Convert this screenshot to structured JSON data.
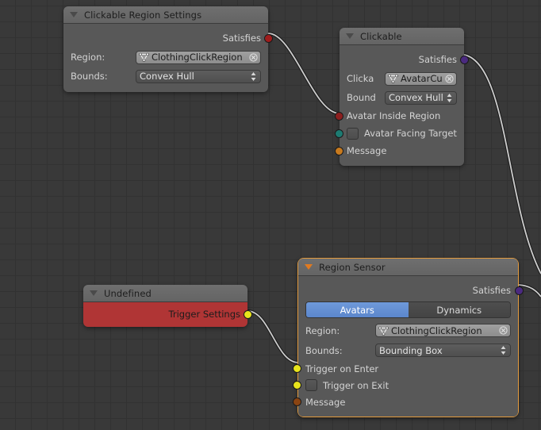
{
  "editor": {
    "background_color": "#393939",
    "grid_color": "#323232"
  },
  "nodes": [
    {
      "id": "clickable-region-settings",
      "title": "Clickable Region Settings",
      "selected": false,
      "outputs": [
        {
          "label": "Satisfies",
          "color": "#a01c1c"
        }
      ],
      "fields": [
        {
          "label": "Region:",
          "type": "id",
          "value": "ClothingClickRegion",
          "icon": "mesh-icon",
          "clear": "x-icon"
        },
        {
          "label": "Bounds:",
          "type": "enum",
          "value": "Convex Hull"
        }
      ]
    },
    {
      "id": "clickable",
      "title": "Clickable",
      "selected": false,
      "outputs": [
        {
          "label": "Satisfies",
          "color": "#4b2a80"
        }
      ],
      "fields": [
        {
          "label": "Clicka",
          "type": "id",
          "value": "AvatarCu",
          "icon": "mesh-icon",
          "clear": "x-icon"
        },
        {
          "label": "Bound",
          "type": "enum",
          "value": "Convex Hull"
        }
      ],
      "inputs": [
        {
          "label": "Avatar Inside Region",
          "color": "#8c1f1f",
          "checkbox": false
        },
        {
          "label": "Avatar Facing Target",
          "color": "#1d7b72",
          "checkbox": true
        },
        {
          "label": "Message",
          "color": "#c87a1e",
          "checkbox": false
        }
      ]
    },
    {
      "id": "undefined-node",
      "title": "Undefined",
      "selected": false,
      "outputs": [
        {
          "label": "Trigger Settings",
          "color": "#e8e41c"
        }
      ]
    },
    {
      "id": "region-sensor",
      "title": "Region Sensor",
      "selected": true,
      "outputs": [
        {
          "label": "Satisfies",
          "color": "#4b2a80"
        }
      ],
      "tabs": [
        {
          "label": "Avatars",
          "active": true
        },
        {
          "label": "Dynamics",
          "active": false
        }
      ],
      "fields": [
        {
          "label": "Region:",
          "type": "id",
          "value": "ClothingClickRegion",
          "icon": "mesh-icon",
          "clear": "x-icon"
        },
        {
          "label": "Bounds:",
          "type": "enum",
          "value": "Bounding Box"
        }
      ],
      "inputs": [
        {
          "label": "Trigger on Enter",
          "color": "#e8e41c",
          "checkbox": false
        },
        {
          "label": "Trigger on Exit",
          "color": "#e8e41c",
          "checkbox": true
        },
        {
          "label": "Message",
          "color": "#8a4412",
          "checkbox": false
        }
      ]
    }
  ],
  "links": [
    {
      "from": "clickable-region-settings.Satisfies",
      "to": "clickable.Avatar Inside Region"
    },
    {
      "from": "undefined-node.Trigger Settings",
      "to": "region-sensor.Trigger on Enter"
    },
    {
      "from": "clickable.Satisfies",
      "to": "offscreen"
    },
    {
      "from": "region-sensor.Satisfies",
      "to": "offscreen"
    }
  ]
}
